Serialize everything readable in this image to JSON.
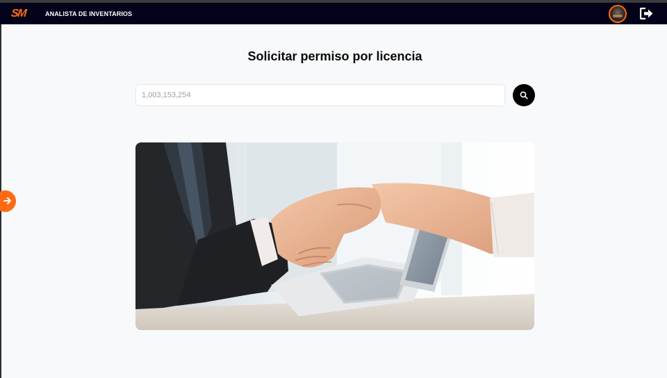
{
  "header": {
    "logo_text": "SM",
    "role": "ANALISTA DE INVENTARIOS"
  },
  "page": {
    "title": "Solicitar permiso por licencia"
  },
  "search": {
    "placeholder": "1,003,153,254"
  },
  "icons": {
    "search": "search-icon",
    "logout": "logout-icon",
    "side_toggle": "arrow-right-icon",
    "avatar": "user-avatar"
  },
  "colors": {
    "navbar_bg": "#02021a",
    "accent": "#ff6a13",
    "page_bg": "#f8f9fb",
    "search_button_bg": "#000000"
  }
}
